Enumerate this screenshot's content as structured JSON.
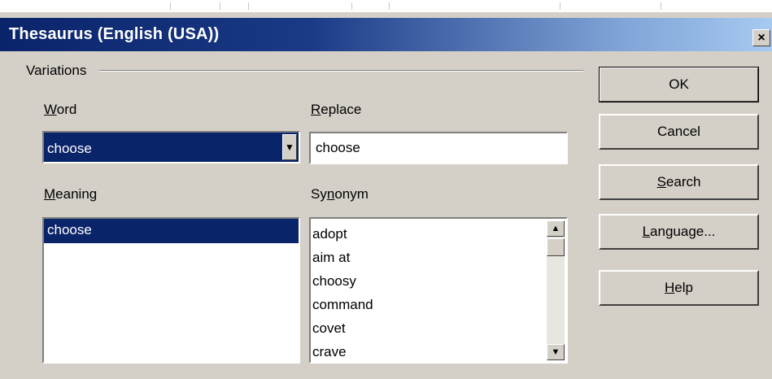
{
  "dialog": {
    "title": "Thesaurus (English (USA))",
    "close_glyph": "×"
  },
  "variations": {
    "group_label": "Variations",
    "word": {
      "label_accel": "W",
      "label_rest": "ord",
      "value": "choose",
      "dropdown_glyph": "▼"
    },
    "replace": {
      "label_accel": "R",
      "label_rest": "eplace",
      "value": "choose"
    },
    "meaning": {
      "label_accel": "M",
      "label_rest": "eaning",
      "items": [
        "choose"
      ],
      "selected": "choose"
    },
    "synonym": {
      "label_pre": "Sy",
      "label_accel": "n",
      "label_rest": "onym",
      "items": [
        "adopt",
        "aim at",
        "choosy",
        "command",
        "covet",
        "crave"
      ]
    }
  },
  "buttons": {
    "ok": "OK",
    "cancel": "Cancel",
    "search_accel": "S",
    "search_rest": "earch",
    "language_accel": "L",
    "language_rest": "anguage...",
    "help_accel": "H",
    "help_rest": "elp"
  },
  "icons": {
    "close": "close-icon",
    "dropdown": "chevron-down-icon",
    "scroll_up": "scroll-up-icon",
    "scroll_down": "scroll-down-icon"
  },
  "colors": {
    "title_start": "#0a246a",
    "title_end": "#a6caf0",
    "selection": "#0a246a",
    "face": "#d4d0c8"
  }
}
